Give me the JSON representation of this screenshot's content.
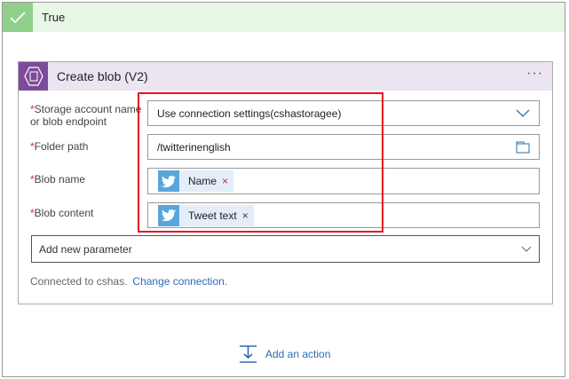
{
  "condition": {
    "label": "True"
  },
  "action": {
    "title": "Create blob (V2)",
    "more": "···",
    "fields": [
      {
        "label_line1": "Storage account name",
        "label_line2": "or blob endpoint",
        "value": "Use connection settings(cshastoragee)"
      },
      {
        "label": "Folder path",
        "value": "/twitterinenglish"
      },
      {
        "label": "Blob name",
        "token": "Name"
      },
      {
        "label": "Blob content",
        "token": "Tweet text"
      }
    ],
    "required_mark": "*",
    "token_remove": "×",
    "add_param": "Add new parameter",
    "connected": "Connected to cshas.",
    "change_connection": "Change connection."
  },
  "add_action": "Add an action",
  "colors": {
    "accent": "#2b6cb0",
    "highlight": "#e81123",
    "twitter": "#5aa6dc"
  }
}
